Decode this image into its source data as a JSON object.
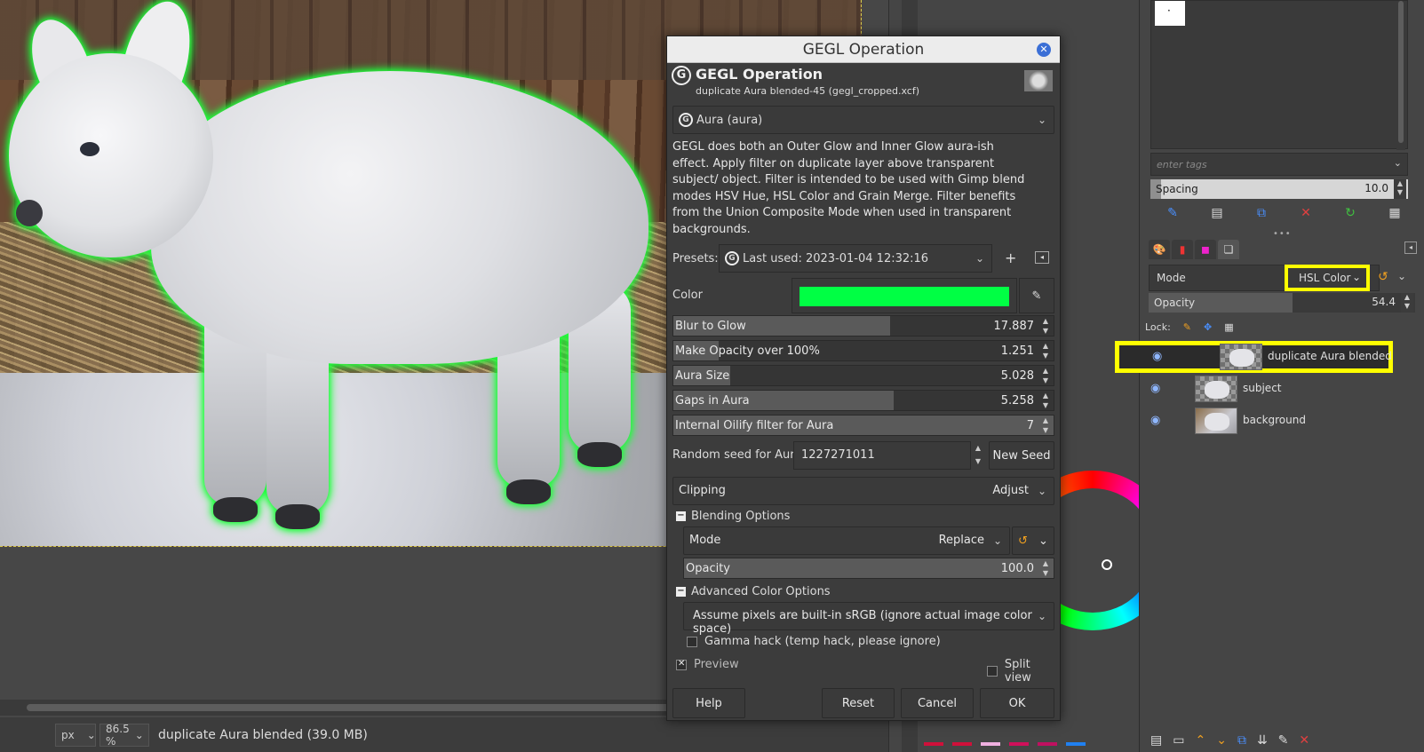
{
  "dialog": {
    "window_title": "GEGL Operation",
    "header_title": "GEGL Operation",
    "header_subtitle": "duplicate Aura blended-45 (gegl_cropped.xcf)",
    "operation": "Aura (aura)",
    "description": "GEGL does both an Outer Glow and Inner Glow aura-ish effect. Apply filter on duplicate layer above transparent subject/ object. Filter is intended to be used with Gimp blend modes HSV Hue, HSL Color and Grain Merge. Filter benefits from the Union Composite Mode when used in transparent backgrounds.",
    "presets_label": "Presets:",
    "presets_value": "Last used: 2023-01-04 12:32:16",
    "color_label": "Color",
    "color_value": "#00ff44",
    "sliders": [
      {
        "label": "Blur to Glow",
        "value": "17.887",
        "fraction": 0.57
      },
      {
        "label": "Make Opacity over 100%",
        "value": "1.251",
        "fraction": 0.12
      },
      {
        "label": "Aura Size",
        "value": "5.028",
        "fraction": 0.15
      },
      {
        "label": "Gaps in Aura",
        "value": "5.258",
        "fraction": 0.58
      },
      {
        "label": "Internal Oilify filter for Aura",
        "value": "7",
        "fraction": 1.0
      }
    ],
    "seed_label": "Random seed for Aura",
    "seed_value": "1227271011",
    "new_seed_label": "New Seed",
    "clipping_label": "Clipping",
    "clipping_value": "Adjust",
    "blending_options_label": "Blending Options",
    "mode_label": "Mode",
    "mode_value": "Replace",
    "opacity_label": "Opacity",
    "opacity_value": "100.0",
    "advanced_label": "Advanced Color Options",
    "advanced_value": "Assume pixels are built-in sRGB (ignore actual image color space)",
    "gamma_label": "Gamma hack (temp hack, please ignore)",
    "preview_label": "Preview",
    "split_label": "Split view",
    "buttons": {
      "help": "Help",
      "reset": "Reset",
      "cancel": "Cancel",
      "ok": "OK"
    }
  },
  "status": {
    "unit": "px",
    "zoom": "86.5 %",
    "text": "duplicate Aura blended (39.0 MB)"
  },
  "right_dock": {
    "tags_placeholder": "enter tags",
    "spacing_label": "Spacing",
    "spacing_value": "10.0",
    "mode_label": "Mode",
    "mode_value": "HSL Color",
    "opacity_label": "Opacity",
    "opacity_value": "54.4",
    "opacity_fraction": 0.54,
    "lock_label": "Lock:",
    "layers": [
      {
        "name": "duplicate Aura blended",
        "selected": true
      },
      {
        "name": "subject",
        "selected": false
      },
      {
        "name": "background",
        "selected": false
      }
    ]
  },
  "colors": {
    "highlight": "#ffff00",
    "aura_green": "#00ff44"
  }
}
